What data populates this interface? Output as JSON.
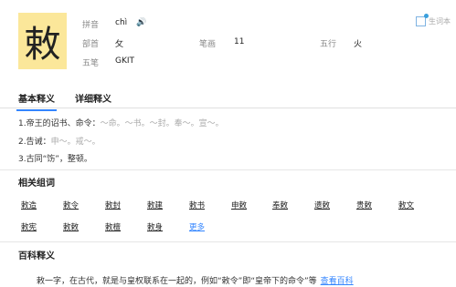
{
  "character": "敕",
  "info": {
    "pinyin_label": "拼音",
    "pinyin": "chì",
    "radical_label": "部首",
    "radical": "攵",
    "strokes_label": "笔画",
    "strokes": "11",
    "wuxing_label": "五行",
    "wuxing": "火",
    "wubi_label": "五笔",
    "wubi": "GKIT",
    "collect": "生词本"
  },
  "tabs": [
    {
      "label": "基本释义"
    },
    {
      "label": "详细释义"
    }
  ],
  "definitions": [
    {
      "num": "1.",
      "text": "帝王的诏书、命令：",
      "ex": "～命。～书。～封。奉～。宣～。"
    },
    {
      "num": "2.",
      "text": "告诫：",
      "ex": "申～。戒～。"
    },
    {
      "num": "3.",
      "text": "古同“饬”，整顿。",
      "ex": ""
    }
  ],
  "related": {
    "title": "相关组词",
    "row1": [
      "敕造",
      "敕令",
      "敕封",
      "敕建",
      "敕书",
      "申敕",
      "奉敕",
      "遗敕",
      "贵敕",
      "敕文"
    ],
    "row2": [
      "敕宪",
      "敕敕",
      "敕檀",
      "敕身"
    ],
    "more": "更多"
  },
  "baike": {
    "title": "百科释义",
    "text": "敕一字，在古代，就是与皇权联系在一起的，例如“敕令”即“皇帝下的命令”等",
    "link": "查看百科"
  },
  "colors": {
    "accent": "#3385ff",
    "char_bg": "#fbe79a"
  },
  "icons": {
    "speaker": "speaker-icon",
    "collect": "add-to-wordbook-icon"
  }
}
